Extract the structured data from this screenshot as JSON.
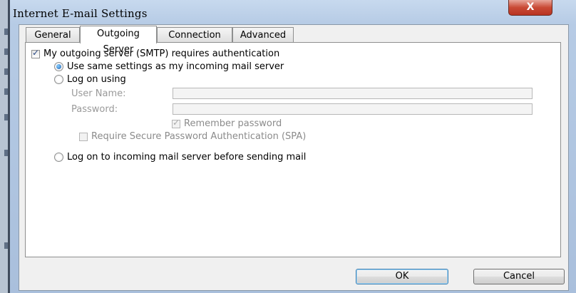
{
  "window": {
    "title": "Internet E-mail Settings",
    "close_label": "X"
  },
  "tabs": [
    {
      "label": "General",
      "active": false
    },
    {
      "label": "Outgoing Server",
      "active": true
    },
    {
      "label": "Connection",
      "active": false
    },
    {
      "label": "Advanced",
      "active": false
    }
  ],
  "outgoing": {
    "smtp_auth_label": "My outgoing server (SMTP) requires authentication",
    "smtp_auth_checked": true,
    "use_same_label": "Use same settings as my incoming mail server",
    "log_on_using_label": "Log on using",
    "user_name_label": "User Name:",
    "user_name_value": "",
    "password_label": "Password:",
    "password_value": "",
    "remember_password_label": "Remember password",
    "remember_password_checked": true,
    "spa_label": "Require Secure Password Authentication (SPA)",
    "spa_checked": false,
    "log_on_incoming_label": "Log on to incoming mail server before sending mail",
    "selected_option": "use_same"
  },
  "buttons": {
    "ok": "OK",
    "cancel": "Cancel"
  },
  "colors": {
    "title_bar": "#b6cbe5",
    "close_button": "#c94a35",
    "radio_selected": "#1b5fb1"
  }
}
